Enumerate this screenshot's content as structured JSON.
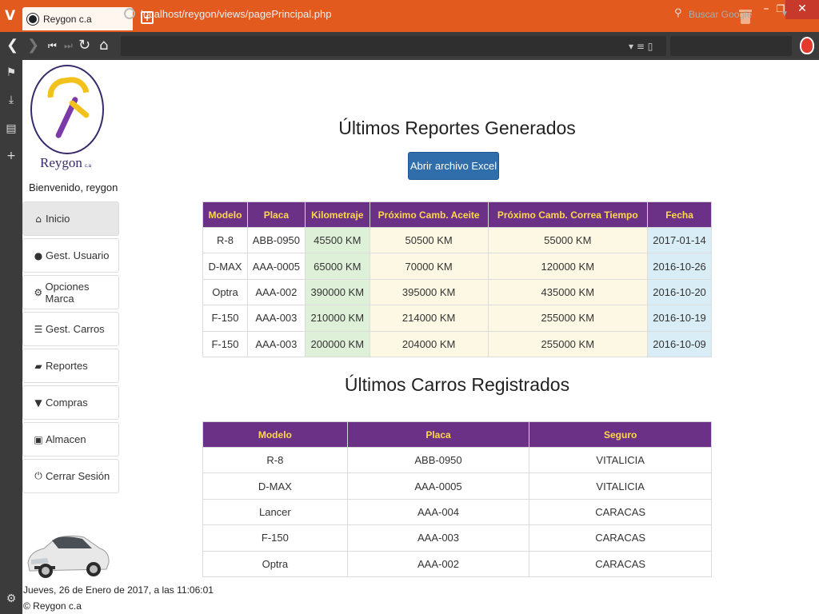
{
  "browser": {
    "tab_title": "Reygon c.a",
    "url": "localhost/reygon/views/pagePrincipal.php",
    "search_placeholder": "Buscar Google"
  },
  "sidebar": {
    "brand_name": "Reygon",
    "brand_suffix": "c.a",
    "welcome": "Bienvenido, reygon",
    "menu": [
      {
        "label": "Inicio",
        "icon": "home-icon"
      },
      {
        "label": "Gest. Usuario",
        "icon": "user-icon"
      },
      {
        "label": "Opciones Marca",
        "icon": "gear-icon"
      },
      {
        "label": "Gest. Carros",
        "icon": "list-icon"
      },
      {
        "label": "Reportes",
        "icon": "folder-open-icon"
      },
      {
        "label": "Compras",
        "icon": "cart-icon"
      },
      {
        "label": "Almacen",
        "icon": "hdd-icon"
      },
      {
        "label": "Cerrar Sesión",
        "icon": "power-icon"
      }
    ],
    "footer_date": "Jueves, 26 de Enero de 2017, a las 11:06:01",
    "footer_copy": "© Reygon c.a"
  },
  "reports": {
    "title": "Últimos Reportes Generados",
    "excel_button": "Abrir archivo Excel",
    "headers": [
      "Modelo",
      "Placa",
      "Kilometraje",
      "Próximo Camb. Aceite",
      "Próximo Camb. Correa Tiempo",
      "Fecha"
    ],
    "rows": [
      [
        "R-8",
        "ABB-0950",
        "45500 KM",
        "50500 KM",
        "55000 KM",
        "2017-01-14"
      ],
      [
        "D-MAX",
        "AAA-0005",
        "65000 KM",
        "70000 KM",
        "120000 KM",
        "2016-10-26"
      ],
      [
        "Optra",
        "AAA-002",
        "390000 KM",
        "395000 KM",
        "435000 KM",
        "2016-10-20"
      ],
      [
        "F-150",
        "AAA-003",
        "210000 KM",
        "214000 KM",
        "255000 KM",
        "2016-10-19"
      ],
      [
        "F-150",
        "AAA-003",
        "200000 KM",
        "204000 KM",
        "255000 KM",
        "2016-10-09"
      ]
    ]
  },
  "cars": {
    "title": "Últimos Carros Registrados",
    "headers": [
      "Modelo",
      "Placa",
      "Seguro"
    ],
    "rows": [
      [
        "R-8",
        "ABB-0950",
        "VITALICIA"
      ],
      [
        "D-MAX",
        "AAA-0005",
        "VITALICIA"
      ],
      [
        "Lancer",
        "AAA-004",
        "CARACAS"
      ],
      [
        "F-150",
        "AAA-003",
        "CARACAS"
      ],
      [
        "Optra",
        "AAA-002",
        "CARACAS"
      ]
    ]
  },
  "colors": {
    "browser_accent": "#e25a1e",
    "table_header_bg": "#6b3187",
    "table_header_text": "#ffd84a",
    "button_primary": "#2f6eab"
  }
}
